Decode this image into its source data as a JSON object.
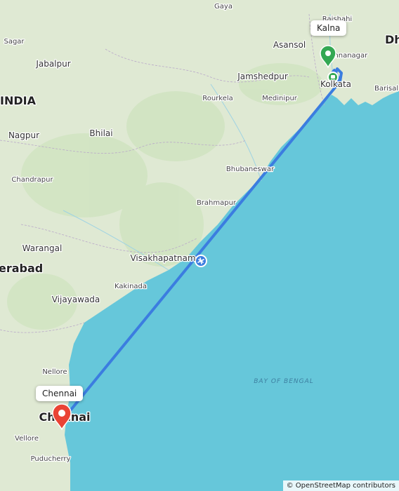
{
  "map": {
    "route_color": "#3b7de0",
    "origin_pin_color": "#34a853",
    "destination_pin_color": "#ea4335",
    "water_color": "#66c7da",
    "land_color": "#dfe9d3"
  },
  "origin": {
    "label": "Kalna"
  },
  "destination": {
    "label": "Chennai"
  },
  "sea_label": "BAY OF BENGAL",
  "country_label": "INDIA",
  "places": {
    "gaya": "Gaya",
    "sagar": "Sagar",
    "asansol": "Asansol",
    "krishnanagar": "Krishnanagar",
    "dhaka": "Dh",
    "jabalpur": "Jabalpur",
    "jamshedpur": "Jamshedpur",
    "kolkata": "Kolkata",
    "barisal": "Barisal",
    "rourkela": "Rourkela",
    "medinipur": "Medinipur",
    "nagpur": "Nagpur",
    "bhilai": "Bhilai",
    "bhubaneswar": "Bhubaneswar",
    "chandrapur": "Chandrapur",
    "brahmapur": "Brahmapur",
    "warangal": "Warangal",
    "visakhapatnam": "Visakhapatnam",
    "hyderabad": "erabad",
    "kakinada": "Kakinada",
    "vijayawada": "Vijayawada",
    "nellore": "Nellore",
    "chennai": "Chennai",
    "vellore": "Vellore",
    "puducherry": "Puducherry",
    "rajshahi": "Rajshahi"
  },
  "attribution": "© OpenStreetMap contributors"
}
